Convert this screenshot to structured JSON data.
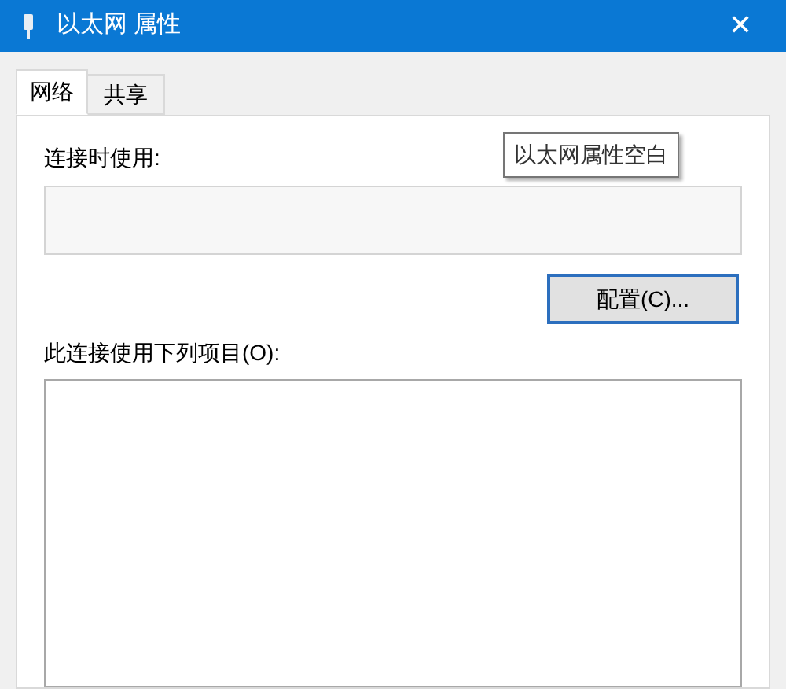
{
  "window": {
    "title": "以太网 属性",
    "close": "✕"
  },
  "tabs": [
    {
      "label": "网络",
      "selected": true
    },
    {
      "label": "共享",
      "selected": false
    }
  ],
  "connect_using": {
    "label": "连接时使用:"
  },
  "tooltip": "以太网属性空白",
  "configure_button": "配置(C)...",
  "items_label": "此连接使用下列项目(O):"
}
